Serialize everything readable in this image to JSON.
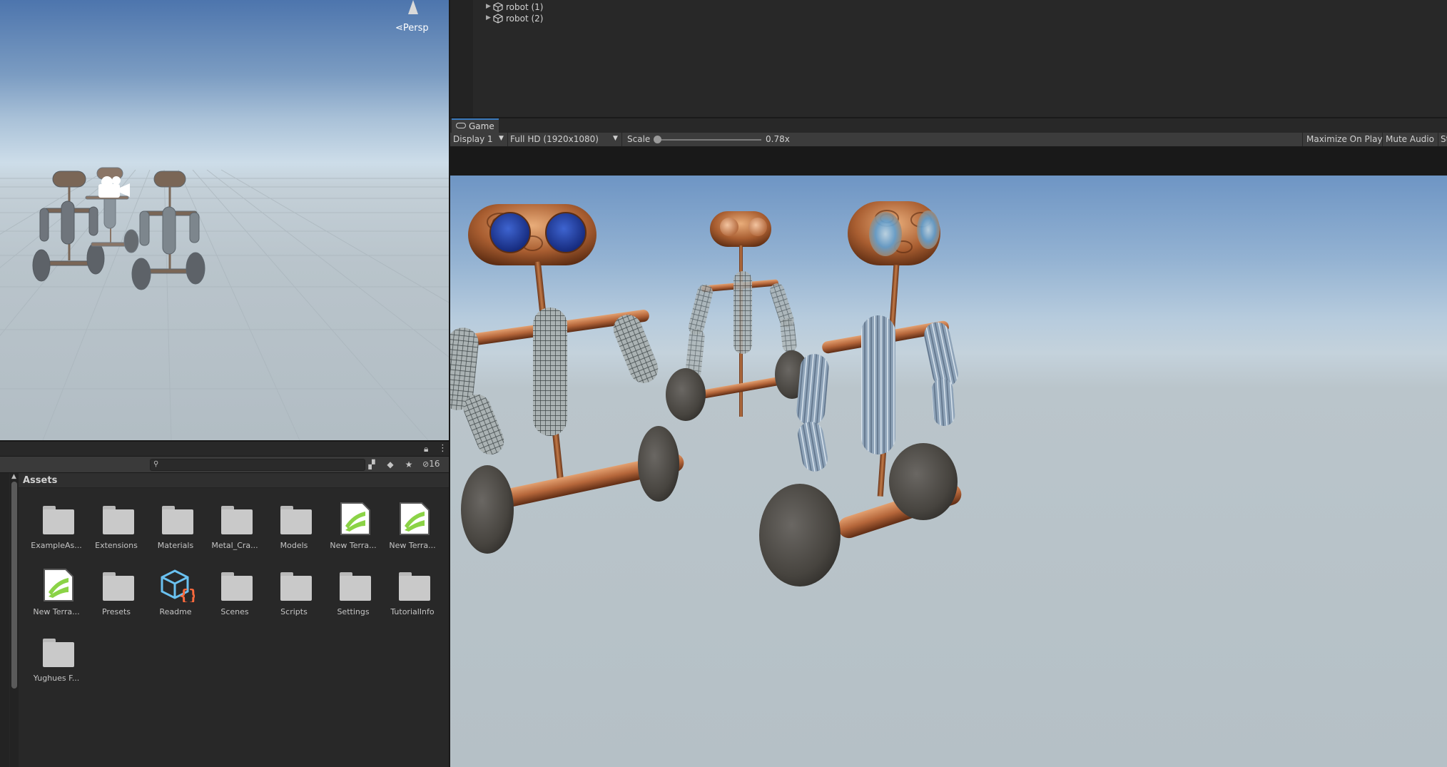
{
  "scene_view": {
    "persp_label": "⋖Persp"
  },
  "project": {
    "hidden_count": "16",
    "search": {
      "placeholder": ""
    },
    "breadcrumb": "Assets",
    "assets": [
      {
        "label": "ExampleAs...",
        "kind": "folder"
      },
      {
        "label": "Extensions",
        "kind": "folder"
      },
      {
        "label": "Materials",
        "kind": "folder"
      },
      {
        "label": "Metal_Cra...",
        "kind": "folder"
      },
      {
        "label": "Models",
        "kind": "folder"
      },
      {
        "label": "New Terra...",
        "kind": "terrain"
      },
      {
        "label": "New Terra...",
        "kind": "terrain"
      },
      {
        "label": "New Terra...",
        "kind": "terrain"
      },
      {
        "label": "Presets",
        "kind": "folder"
      },
      {
        "label": "Readme",
        "kind": "readme"
      },
      {
        "label": "Scenes",
        "kind": "folder"
      },
      {
        "label": "Scripts",
        "kind": "folder"
      },
      {
        "label": "Settings",
        "kind": "folder"
      },
      {
        "label": "TutorialInfo",
        "kind": "folder"
      },
      {
        "label": "Yughues F...",
        "kind": "folder"
      }
    ]
  },
  "hierarchy": {
    "items": [
      {
        "label": "robot (1)"
      },
      {
        "label": "robot (2)"
      }
    ]
  },
  "game": {
    "tab_label": "Game",
    "display": "Display 1",
    "resolution": "Full HD (1920x1080)",
    "scale_label": "Scale",
    "scale_value": "0.78x",
    "scale_level": 0.0,
    "maximize_on_play": "Maximize On Play",
    "mute_audio": "Mute Audio",
    "stats_label": "St"
  },
  "colors": {
    "accent_tab": "#3a79bb",
    "copper": "#b86c3e",
    "blue_eye": "#1e3f9c",
    "terrain_green": "#8bd346",
    "readme_blue": "#6ac1f0",
    "readme_orange": "#ff6a3d"
  }
}
